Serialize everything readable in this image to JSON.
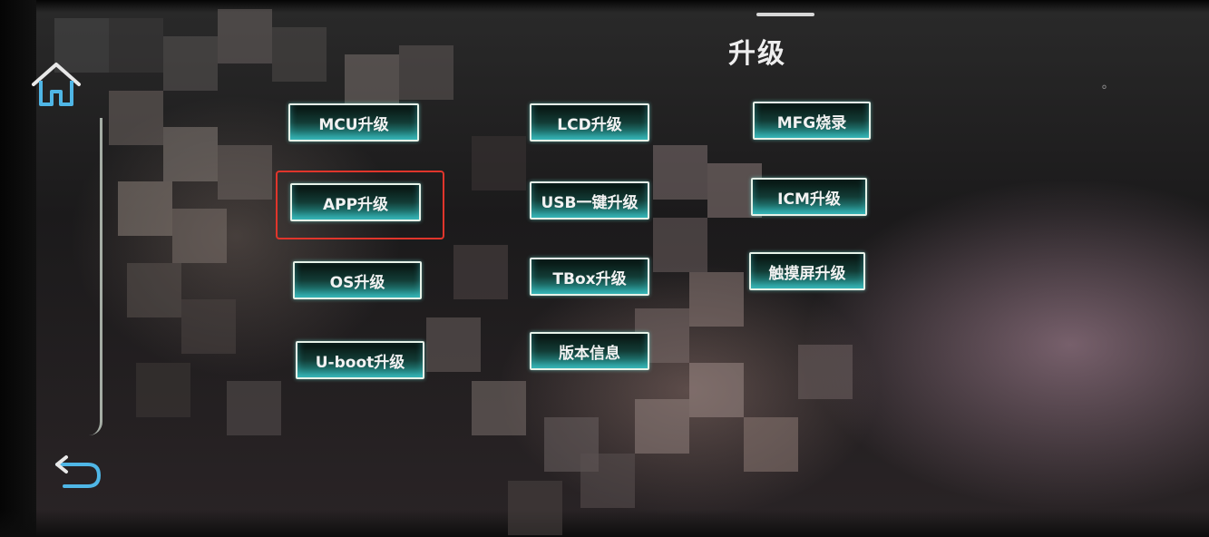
{
  "header": {
    "title": "升级"
  },
  "nav": {
    "home_icon": "home-icon",
    "back_icon": "back-arrow-icon"
  },
  "menu": {
    "column1": [
      "MCU升级",
      "APP升级",
      "OS升级",
      "U-boot升级"
    ],
    "column2": [
      "LCD升级",
      "USB一键升级",
      "TBox升级",
      "版本信息"
    ],
    "column3": [
      "MFG烧录",
      "ICM升级",
      "触摸屏升级"
    ]
  },
  "highlighted_item": "APP升级",
  "colors": {
    "button_border": "#e6f2e8",
    "button_glow": "#2ba3a0",
    "highlight": "#e0352b",
    "icon_blue": "#4fb6e6"
  }
}
